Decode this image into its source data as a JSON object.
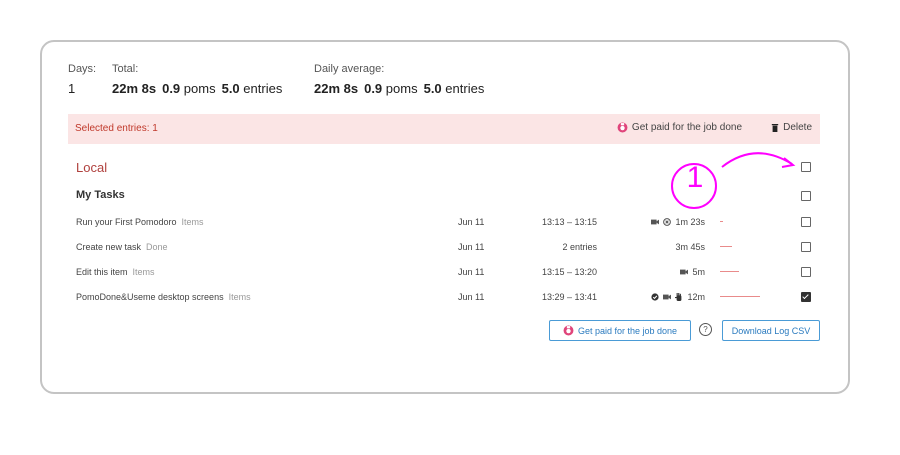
{
  "summary": {
    "days_label": "Days:",
    "total_label": "Total:",
    "daily_label": "Daily average:",
    "days_value": "1",
    "total_time": "22m 8s",
    "total_poms_value": "0.9",
    "total_poms_unit": "poms",
    "total_entries_value": "5.0",
    "total_entries_unit": "entries",
    "daily_time": "22m 8s",
    "daily_poms_value": "0.9",
    "daily_poms_unit": "poms",
    "daily_entries_value": "5.0",
    "daily_entries_unit": "entries"
  },
  "selection_bar": {
    "selected_text": "Selected entries: 1",
    "paid_label": "Get paid for the job done",
    "delete_label": "Delete"
  },
  "project_name": "Local",
  "task_group": "My Tasks",
  "annotation": {
    "marker": "1"
  },
  "rows": [
    {
      "name": "Run your First Pomodoro",
      "tag": "Items",
      "date": "Jun 11",
      "time": "13:13 – 13:15",
      "duration": "1m 23s",
      "checked": false,
      "progress": 0.05
    },
    {
      "name": "Create new task",
      "tag": "Done",
      "date": "Jun 11",
      "time": "2 entries",
      "duration": "3m 45s",
      "checked": false,
      "progress": 0.2
    },
    {
      "name": "Edit this item",
      "tag": "Items",
      "date": "Jun 11",
      "time": "13:15 – 13:20",
      "duration": "5m",
      "checked": false,
      "progress": 0.3
    },
    {
      "name": "PomoDone&Useme desktop screens",
      "tag": "Items",
      "date": "Jun 11",
      "time": "13:29 – 13:41",
      "duration": "12m",
      "checked": true,
      "progress": 0.65
    }
  ],
  "footer": {
    "paid_button": "Get paid for the job done",
    "help_icon": "?",
    "download_button": "Download Log CSV"
  },
  "colors": {
    "accent_red": "#b0413e",
    "bar_bg": "#fbe5e5",
    "link_blue": "#2b7bbf",
    "annotation_magenta": "#ff00ff"
  }
}
